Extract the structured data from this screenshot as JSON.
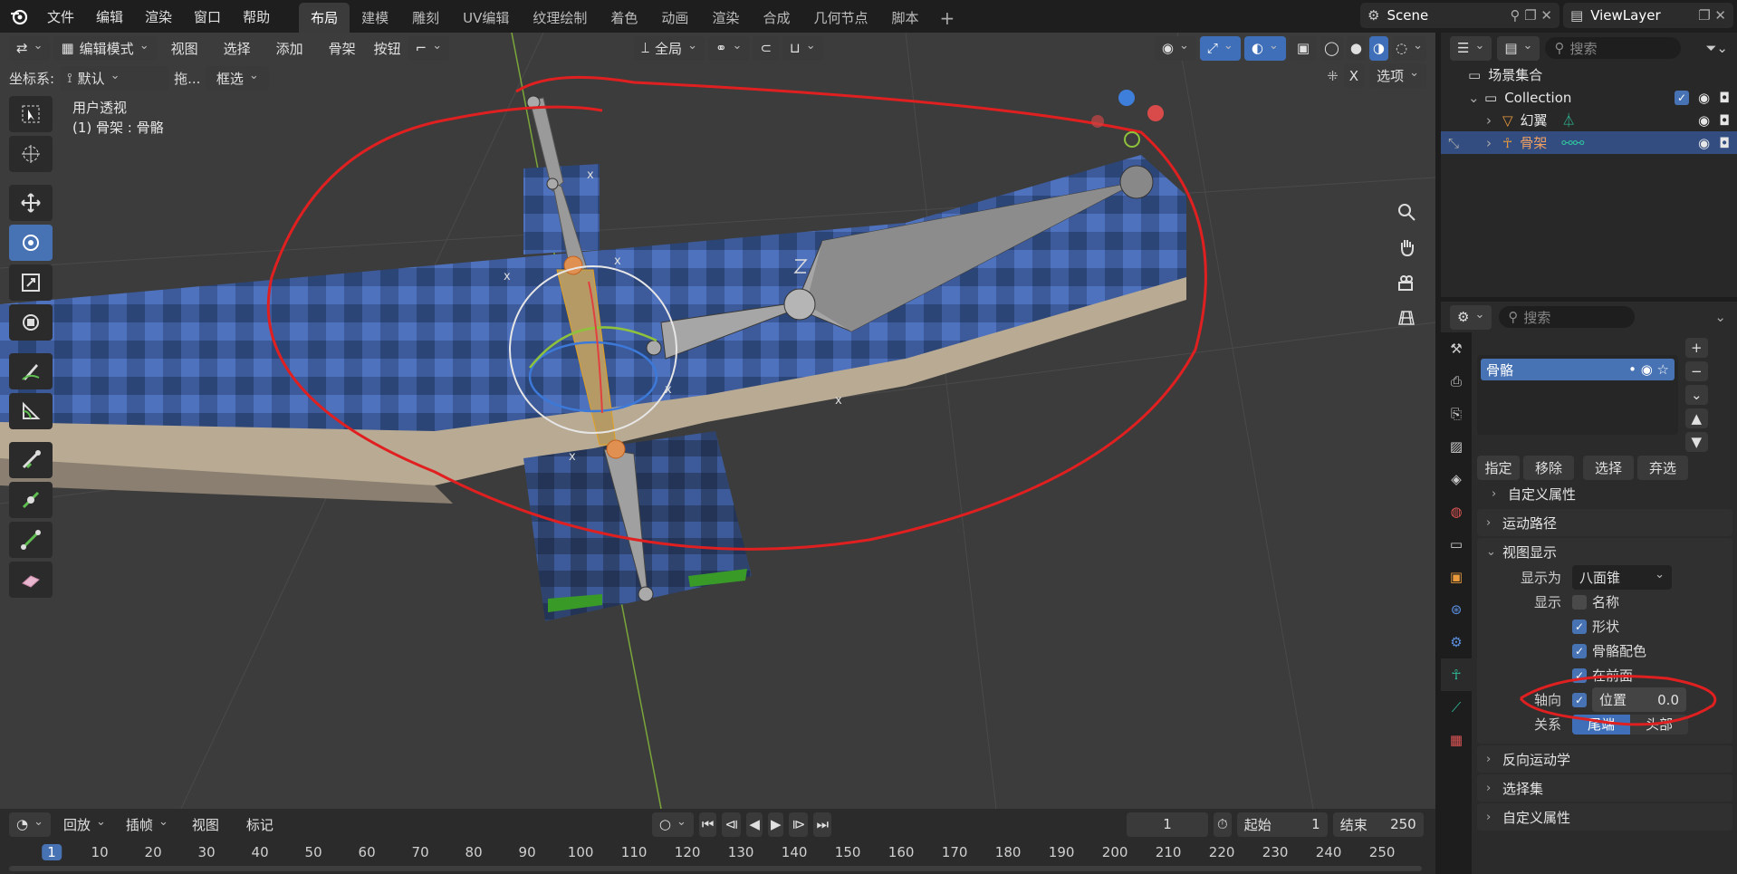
{
  "topbar": {
    "menus": [
      "文件",
      "编辑",
      "渲染",
      "窗口",
      "帮助"
    ],
    "workspaces": [
      "布局",
      "建模",
      "雕刻",
      "UV编辑",
      "纹理绘制",
      "着色",
      "动画",
      "渲染",
      "合成",
      "几何节点",
      "脚本"
    ],
    "active_workspace": "布局",
    "plus": "+",
    "scene": "Scene",
    "view_layer": "ViewLayer"
  },
  "viewport": {
    "mode": "编辑模式",
    "menus": [
      "视图",
      "选择",
      "添加",
      "骨架",
      "按钮"
    ],
    "transform_orientation": "全局",
    "coord_label": "坐标系:",
    "coord_value": "默认",
    "drag_label": "拖...",
    "select_mode": "框选",
    "options": "选项",
    "x_label": "X",
    "view_name": "用户透视",
    "object_info": "(1) 骨架 : 骨骼"
  },
  "outliner": {
    "search_placeholder": "搜索",
    "scene_collection": "场景集合",
    "items": [
      {
        "label": "Collection"
      },
      {
        "label": "幻翼"
      },
      {
        "label": "骨架"
      }
    ]
  },
  "properties": {
    "search_placeholder": "搜索",
    "bone_collection": "骨骼",
    "buttons": [
      "指定",
      "移除",
      "选择",
      "弃选"
    ],
    "custom_props": "自定义属性",
    "motion_paths": "运动路径",
    "viewport_display": "视图显示",
    "display_as_label": "显示为",
    "display_as_value": "八面锥",
    "show_label": "显示",
    "show_names": "名称",
    "show_shapes": "形状",
    "show_bone_colors": "骨骼配色",
    "show_in_front": "在前面",
    "axes_label": "轴向",
    "axes_position_label": "位置",
    "axes_position_value": "0.0",
    "relation_label": "关系",
    "relation_tail": "尾端",
    "relation_head": "头部",
    "ik": "反向运动学",
    "selection_sets": "选择集",
    "custom_props2": "自定义属性"
  },
  "timeline": {
    "playback": "回放",
    "keying": "插帧",
    "view": "视图",
    "marker": "标记",
    "current_frame": "1",
    "start_label": "起始",
    "start_value": "1",
    "end_label": "结束",
    "end_value": "250",
    "ruler_current": "1",
    "ticks": [
      "10",
      "20",
      "30",
      "40",
      "50",
      "60",
      "70",
      "80",
      "90",
      "100",
      "110",
      "120",
      "130",
      "140",
      "150",
      "160",
      "170",
      "180",
      "190",
      "200",
      "210",
      "220",
      "230",
      "240",
      "250"
    ]
  },
  "colors": {
    "accent": "#4772b3",
    "annotation": "#e02020",
    "selected_row": "#334d80"
  }
}
